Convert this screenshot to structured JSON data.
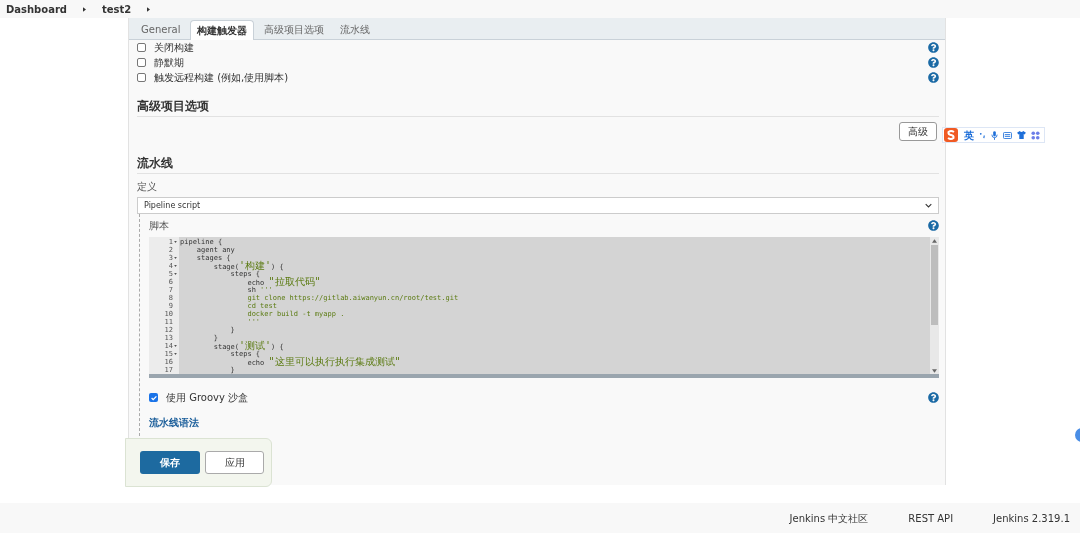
{
  "breadcrumb": [
    {
      "label": "Dashboard"
    },
    {
      "label": "test2"
    }
  ],
  "tabs": [
    {
      "label": "General",
      "selected": false
    },
    {
      "label": "构建触发器",
      "selected": true
    },
    {
      "label": "高级项目选项",
      "selected": false
    },
    {
      "label": "流水线",
      "selected": false
    }
  ],
  "triggers": [
    {
      "label": "关闭构建",
      "checked": false
    },
    {
      "label": "静默期",
      "checked": false
    },
    {
      "label": "触发远程构建 (例如,使用脚本)",
      "checked": false
    }
  ],
  "advanced_options": {
    "heading": "高级项目选项",
    "button": "高级"
  },
  "ime_toolbar": {
    "language": "英"
  },
  "pipeline": {
    "heading": "流水线",
    "definition_label": "定义",
    "definition_value": "Pipeline script",
    "script_label": "脚本",
    "script_lines": [
      {
        "number": "1",
        "fold": true,
        "parts": [
          {
            "kind": "code",
            "text": "pipeline {"
          }
        ]
      },
      {
        "number": "2",
        "fold": false,
        "parts": [
          {
            "kind": "code",
            "text": "    agent any"
          }
        ]
      },
      {
        "number": "3",
        "fold": true,
        "parts": [
          {
            "kind": "code",
            "text": "    stages {"
          }
        ]
      },
      {
        "number": "4",
        "fold": true,
        "parts": [
          {
            "kind": "code",
            "text": "        stage("
          },
          {
            "kind": "string",
            "text": "'构建'"
          },
          {
            "kind": "code",
            "text": ") {"
          }
        ]
      },
      {
        "number": "5",
        "fold": true,
        "parts": [
          {
            "kind": "code",
            "text": "            steps {"
          }
        ]
      },
      {
        "number": "6",
        "fold": false,
        "parts": [
          {
            "kind": "code",
            "text": "                echo "
          },
          {
            "kind": "string",
            "text": "\"拉取代码\""
          }
        ]
      },
      {
        "number": "7",
        "fold": false,
        "parts": [
          {
            "kind": "code",
            "text": "                sh "
          },
          {
            "kind": "string",
            "text": "'''"
          }
        ]
      },
      {
        "number": "8",
        "fold": false,
        "parts": [
          {
            "kind": "string",
            "text": "                git clone https://gitlab.aiwanyun.cn/root/test.git"
          }
        ]
      },
      {
        "number": "9",
        "fold": false,
        "parts": [
          {
            "kind": "string",
            "text": "                cd test"
          }
        ]
      },
      {
        "number": "10",
        "fold": false,
        "parts": [
          {
            "kind": "string",
            "text": "                docker build -t myapp ."
          }
        ]
      },
      {
        "number": "11",
        "fold": false,
        "parts": [
          {
            "kind": "string",
            "text": "                '''"
          }
        ]
      },
      {
        "number": "12",
        "fold": false,
        "parts": [
          {
            "kind": "code",
            "text": "            }"
          }
        ]
      },
      {
        "number": "13",
        "fold": false,
        "parts": [
          {
            "kind": "code",
            "text": "        }"
          }
        ]
      },
      {
        "number": "14",
        "fold": true,
        "parts": [
          {
            "kind": "code",
            "text": "        stage("
          },
          {
            "kind": "string",
            "text": "'测试'"
          },
          {
            "kind": "code",
            "text": ") {"
          }
        ]
      },
      {
        "number": "15",
        "fold": true,
        "parts": [
          {
            "kind": "code",
            "text": "            steps {"
          }
        ]
      },
      {
        "number": "16",
        "fold": false,
        "parts": [
          {
            "kind": "code",
            "text": "                echo "
          },
          {
            "kind": "string",
            "text": "\"这里可以执行执行集成测试\""
          }
        ]
      },
      {
        "number": "17",
        "fold": false,
        "parts": [
          {
            "kind": "code",
            "text": "            }"
          }
        ]
      }
    ],
    "groovy_sandbox": {
      "label": "使用 Groovy 沙盒",
      "checked": true
    },
    "syntax_link": "流水线语法"
  },
  "actions": [
    {
      "label": "保存",
      "kind": "primary"
    },
    {
      "label": "应用",
      "kind": "secondary"
    }
  ],
  "footer": [
    "Jenkins 中文社区",
    "REST API",
    "Jenkins 2.319.1"
  ]
}
